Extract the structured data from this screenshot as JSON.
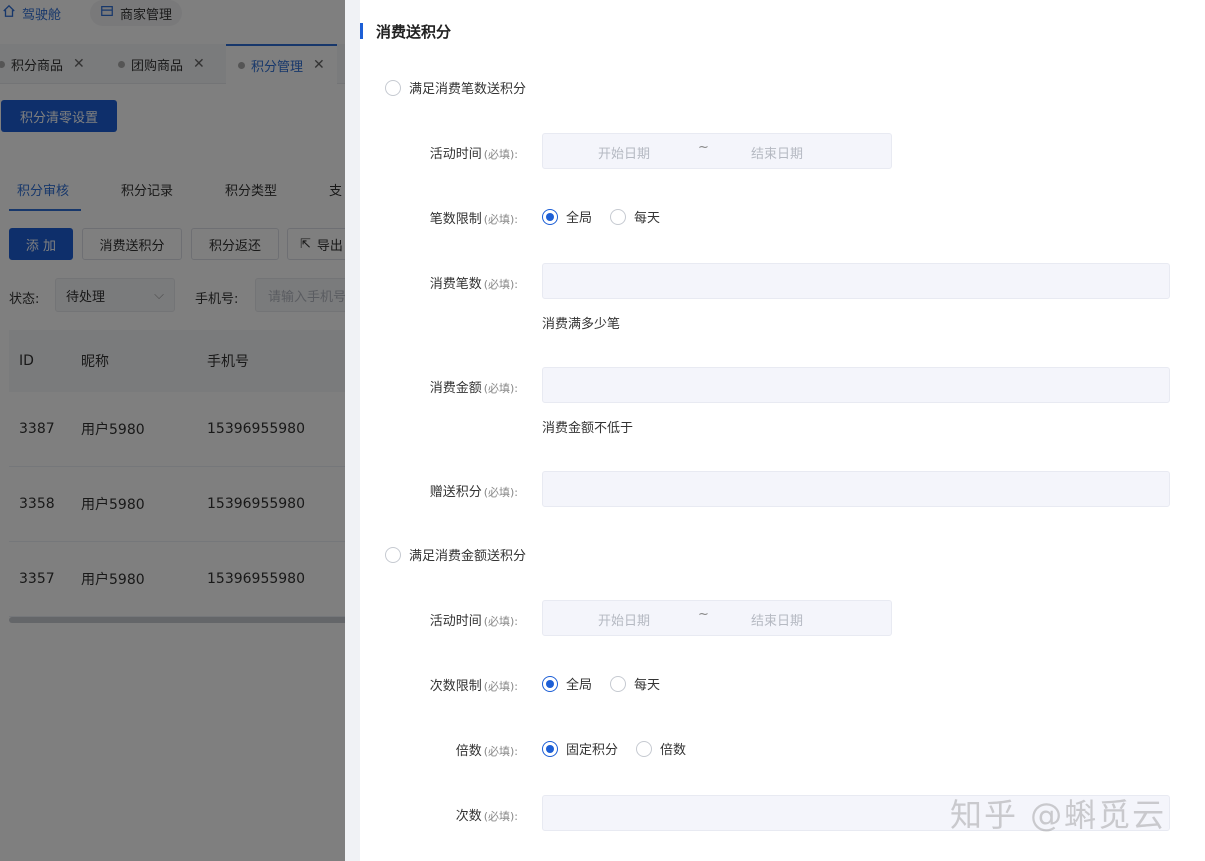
{
  "topbar": {
    "cockpit_label": "驾驶舱",
    "merchant_label": "商家管理"
  },
  "page_tabs": [
    {
      "label": "积分商品"
    },
    {
      "label": "团购商品"
    },
    {
      "label": "积分管理"
    }
  ],
  "clear_button": "积分清零设置",
  "sub_tabs": [
    {
      "label": "积分审核"
    },
    {
      "label": "积分记录"
    },
    {
      "label": "积分类型"
    },
    {
      "label": "支"
    }
  ],
  "actions": {
    "add": "添 加",
    "consume_points": "消费送积分",
    "points_return": "积分返还",
    "export": "导出"
  },
  "filters": {
    "status_label": "状态:",
    "status_value": "待处理",
    "phone_label": "手机号:",
    "phone_placeholder": "请输入手机号"
  },
  "table": {
    "headers": [
      "ID",
      "昵称",
      "手机号"
    ],
    "rows": [
      [
        "3387",
        "用户5980",
        "15396955980"
      ],
      [
        "3358",
        "用户5980",
        "15396955980"
      ],
      [
        "3357",
        "用户5980",
        "15396955980"
      ]
    ]
  },
  "drawer": {
    "title": "消费送积分",
    "required_tag": "(必填):",
    "section1": {
      "radio_label": "满足消费笔数送积分",
      "activity_time_label": "活动时间",
      "start_placeholder": "开始日期",
      "separator": "~",
      "end_placeholder": "结束日期",
      "count_limit_label": "笔数限制",
      "opt_global": "全局",
      "opt_daily": "每天",
      "consume_count_label": "消费笔数",
      "consume_count_help": "消费满多少笔",
      "consume_amount_label": "消费金额",
      "consume_amount_help": "消费金额不低于",
      "gift_points_label": "赠送积分"
    },
    "section2": {
      "radio_label": "满足消费金额送积分",
      "activity_time_label": "活动时间",
      "start_placeholder": "开始日期",
      "separator": "~",
      "end_placeholder": "结束日期",
      "times_limit_label": "次数限制",
      "opt_global": "全局",
      "opt_daily": "每天",
      "multiple_label": "倍数",
      "opt_fixed": "固定积分",
      "opt_multiple": "倍数",
      "times_label": "次数"
    }
  },
  "watermark": "知乎 @蝌觅云",
  "colors": {
    "accent": "#1d5fd6",
    "input_bg": "#f4f5fb"
  }
}
